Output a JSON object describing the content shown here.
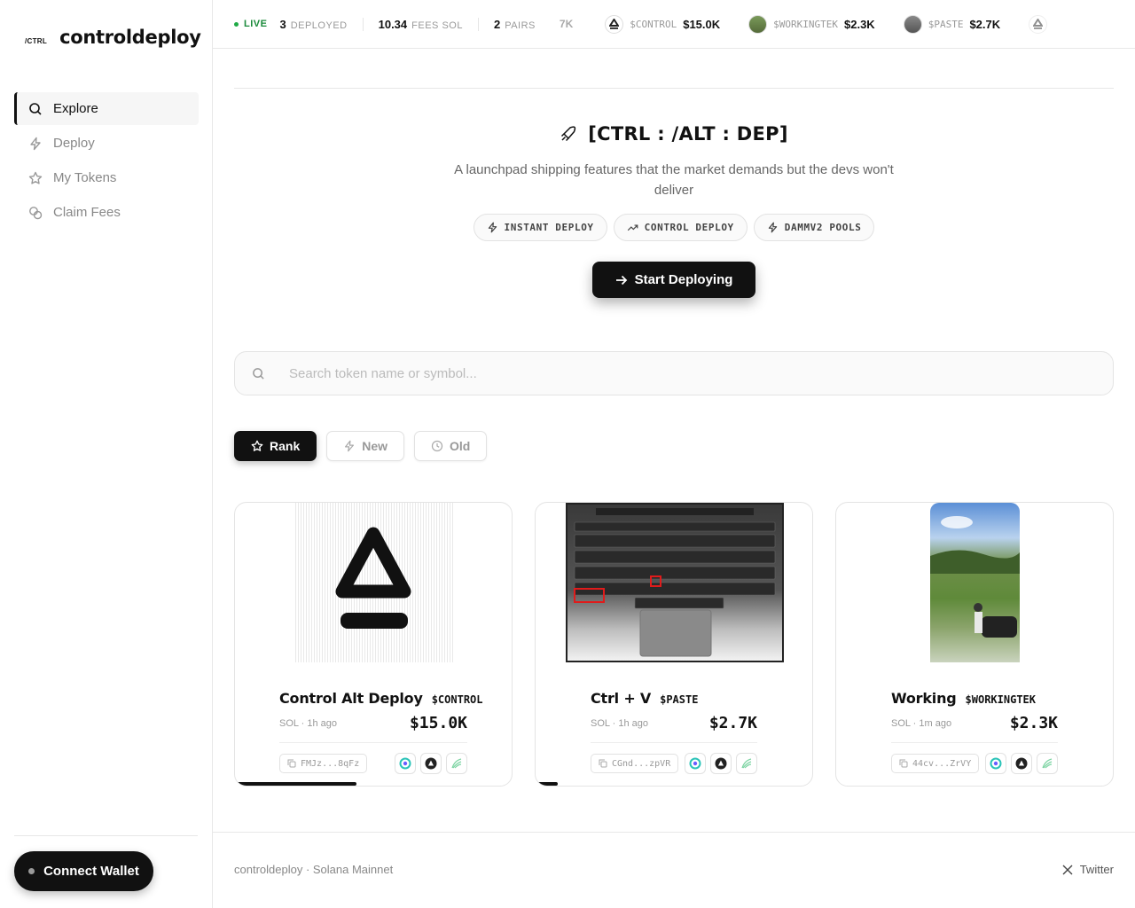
{
  "brand": {
    "tag": "/CTRL",
    "name": "controldeploy"
  },
  "nav": {
    "items": [
      {
        "label": "Explore",
        "icon": "search-icon",
        "active": true
      },
      {
        "label": "Deploy",
        "icon": "lightning-icon"
      },
      {
        "label": "My Tokens",
        "icon": "star-icon"
      },
      {
        "label": "Claim Fees",
        "icon": "coins-icon"
      }
    ]
  },
  "wallet": {
    "connect_label": "Connect Wallet"
  },
  "ticker": {
    "live_label": "LIVE",
    "stats": [
      {
        "value": "3",
        "label": "DEPLOYED"
      },
      {
        "value": "10.34",
        "label": "FEES SOL"
      },
      {
        "value": "2",
        "label": "PAIRS"
      }
    ],
    "fade_text": "7K",
    "tokens": [
      {
        "symbol": "$CONTROL",
        "value": "$15.0K"
      },
      {
        "symbol": "$WORKINGTEK",
        "value": "$2.3K"
      },
      {
        "symbol": "$PASTE",
        "value": "$2.7K"
      }
    ]
  },
  "hero": {
    "title": "[CTRL : /ALT : DEP]",
    "subtitle": "A launchpad shipping features that the market demands but the devs won't deliver",
    "chips": [
      "INSTANT DEPLOY",
      "CONTROL DEPLOY",
      "DAMMV2 POOLS"
    ],
    "cta_label": "Start Deploying"
  },
  "search": {
    "placeholder": "Search token name or symbol..."
  },
  "sort": {
    "options": [
      "Rank",
      "New",
      "Old"
    ],
    "active": "Rank"
  },
  "tokens": [
    {
      "name": "Control Alt Deploy",
      "symbol": "$CONTROL",
      "meta": "SOL · 1h ago",
      "mcap": "$15.0K",
      "address": "FMJz...8qFz",
      "progress": 0.44
    },
    {
      "name": "Ctrl + V",
      "symbol": "$PASTE",
      "meta": "SOL · 1h ago",
      "mcap": "$2.7K",
      "address": "CGnd...zpVR",
      "progress": 0.08
    },
    {
      "name": "Working",
      "symbol": "$WORKINGTEK",
      "meta": "SOL · 1m ago",
      "mcap": "$2.3K",
      "address": "44cv...ZrVY",
      "progress": 0
    }
  ],
  "footer": {
    "left": "controldeploy · Solana Mainnet",
    "right": "Twitter"
  },
  "colors": {
    "accent": "#111111",
    "live": "#1a8a3a"
  }
}
